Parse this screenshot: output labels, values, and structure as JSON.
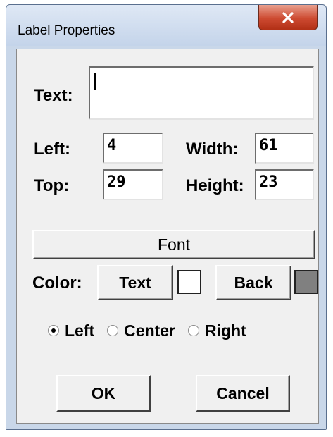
{
  "window": {
    "title": "Label Properties",
    "close_glyph": "x"
  },
  "fields": {
    "text_label": "Text:",
    "text_value": "",
    "left_label": "Left:",
    "left_value": "4",
    "top_label": "Top:",
    "top_value": "29",
    "width_label": "Width:",
    "width_value": "61",
    "height_label": "Height:",
    "height_value": "23"
  },
  "font_button": "Font",
  "color": {
    "label": "Color:",
    "text_button": "Text",
    "text_swatch": "#ffffff",
    "back_button": "Back",
    "back_swatch": "#808080"
  },
  "alignment": {
    "options": [
      "Left",
      "Center",
      "Right"
    ],
    "selected": "Left"
  },
  "buttons": {
    "ok": "OK",
    "cancel": "Cancel"
  }
}
